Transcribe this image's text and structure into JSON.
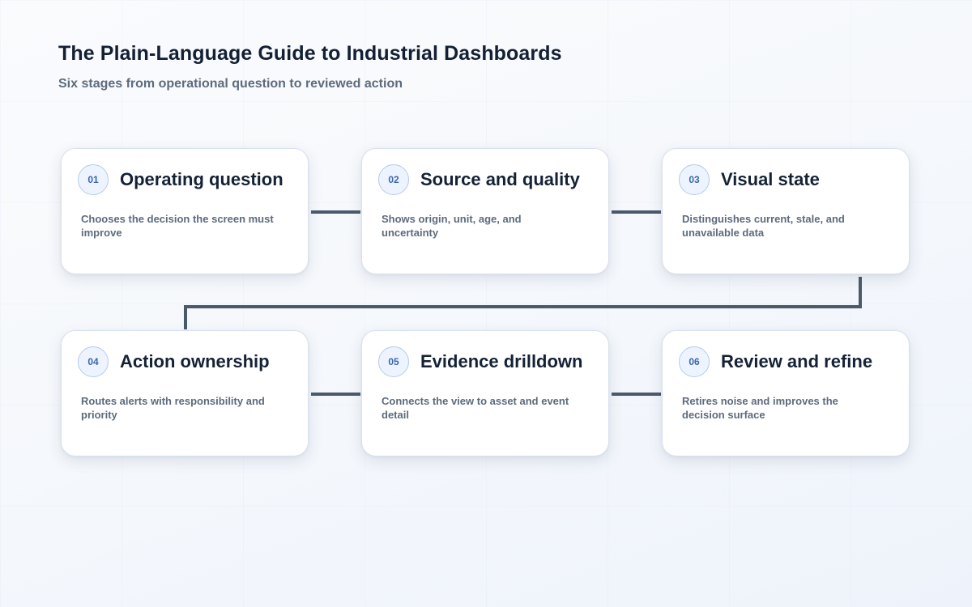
{
  "header": {
    "title": "The Plain-Language Guide to Industrial Dashboards",
    "subtitle": "Six stages from operational question to reviewed action"
  },
  "stages": [
    {
      "number": "01",
      "title": "Operating question",
      "description": "Chooses the decision the screen must improve"
    },
    {
      "number": "02",
      "title": "Source and quality",
      "description": "Shows origin, unit, age, and uncertainty"
    },
    {
      "number": "03",
      "title": "Visual state",
      "description": "Distinguishes current, stale, and unavailable data"
    },
    {
      "number": "04",
      "title": "Action ownership",
      "description": "Routes alerts with responsibility and priority"
    },
    {
      "number": "05",
      "title": "Evidence drilldown",
      "description": "Connects the view to asset and event detail"
    },
    {
      "number": "06",
      "title": "Review and refine",
      "description": "Retires noise and improves the decision surface"
    }
  ],
  "colors": {
    "connector": "#4b5a6b",
    "badge_text": "#3b66ad",
    "badge_border": "#b4cbe9",
    "title_text": "#132034",
    "body_text": "#5d6b7c"
  }
}
